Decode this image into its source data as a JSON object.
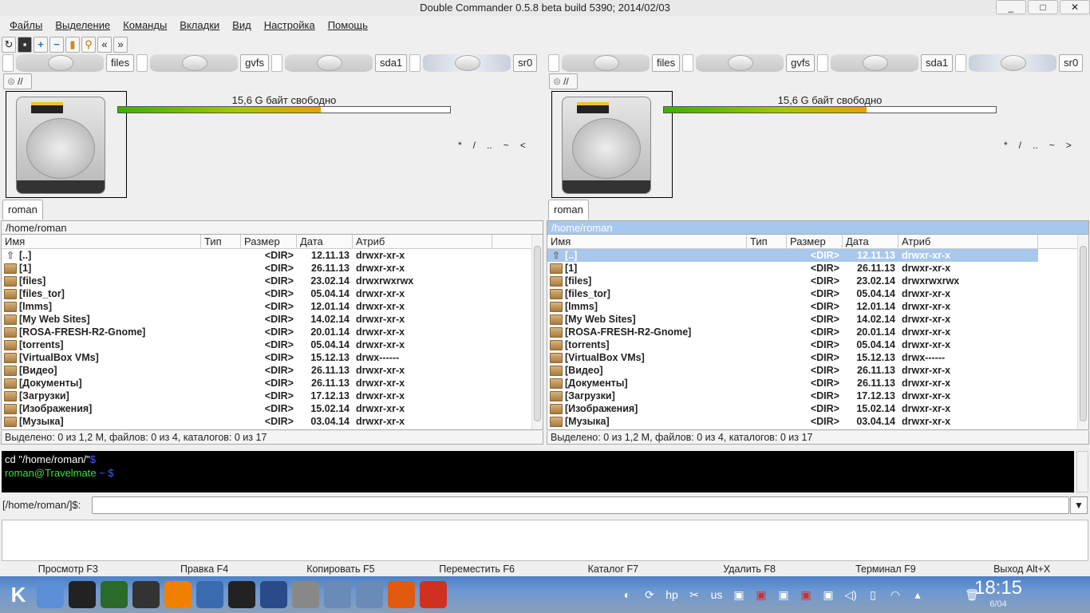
{
  "window": {
    "title": "Double Commander 0.5.8 beta build 5390; 2014/02/03",
    "minimize": "_",
    "maximize": "□",
    "close": "✕"
  },
  "menu": [
    "Файлы",
    "Выделение",
    "Команды",
    "Вкладки",
    "Вид",
    "Настройка",
    "Помощь"
  ],
  "toolbar": [
    "refresh-icon",
    "terminal-icon",
    "plus-icon",
    "minus-icon",
    "clipboard-icon",
    "search-icon",
    "back-icon",
    "forward-icon"
  ],
  "drives": [
    "files",
    "gvfs",
    "sda1",
    "sr0"
  ],
  "root_button": "//",
  "panels": [
    {
      "tab": "roman",
      "path": "/home/roman",
      "free_label": "15,6 G байт свободно",
      "used_fraction": 0.61,
      "nav": [
        "*",
        "/",
        "..",
        "~",
        "<"
      ],
      "active": false,
      "status": "Выделено: 0 из 1,2 M, файлов: 0 из 4, каталогов: 0 из 17"
    },
    {
      "tab": "roman",
      "path": "/home/roman",
      "free_label": "15,6 G байт свободно",
      "used_fraction": 0.61,
      "nav": [
        "*",
        "/",
        "..",
        "~",
        ">"
      ],
      "active": true,
      "status": "Выделено: 0 из 1,2 M, файлов: 0 из 4, каталогов: 0 из 17"
    }
  ],
  "columns": [
    "Имя",
    "Тип",
    "Размер",
    "Дата",
    "Атриб"
  ],
  "files": [
    {
      "name": "[..]",
      "size": "<DIR>",
      "date": "12.11.13",
      "attr": "drwxr-xr-x",
      "up": true
    },
    {
      "name": "[1]",
      "size": "<DIR>",
      "date": "26.11.13",
      "attr": "drwxr-xr-x"
    },
    {
      "name": "[files]",
      "size": "<DIR>",
      "date": "23.02.14",
      "attr": "drwxrwxrwx"
    },
    {
      "name": "[files_tor]",
      "size": "<DIR>",
      "date": "05.04.14",
      "attr": "drwxr-xr-x"
    },
    {
      "name": "[lmms]",
      "size": "<DIR>",
      "date": "12.01.14",
      "attr": "drwxr-xr-x"
    },
    {
      "name": "[My Web Sites]",
      "size": "<DIR>",
      "date": "14.02.14",
      "attr": "drwxr-xr-x"
    },
    {
      "name": "[ROSA-FRESH-R2-Gnome]",
      "size": "<DIR>",
      "date": "20.01.14",
      "attr": "drwxr-xr-x"
    },
    {
      "name": "[torrents]",
      "size": "<DIR>",
      "date": "05.04.14",
      "attr": "drwxr-xr-x"
    },
    {
      "name": "[VirtualBox VMs]",
      "size": "<DIR>",
      "date": "15.12.13",
      "attr": "drwx------"
    },
    {
      "name": "[Видео]",
      "size": "<DIR>",
      "date": "26.11.13",
      "attr": "drwxr-xr-x"
    },
    {
      "name": "[Документы]",
      "size": "<DIR>",
      "date": "26.11.13",
      "attr": "drwxr-xr-x"
    },
    {
      "name": "[Загрузки]",
      "size": "<DIR>",
      "date": "17.12.13",
      "attr": "drwxr-xr-x"
    },
    {
      "name": "[Изображения]",
      "size": "<DIR>",
      "date": "15.02.14",
      "attr": "drwxr-xr-x"
    },
    {
      "name": "[Музыка]",
      "size": "<DIR>",
      "date": "03.04.14",
      "attr": "drwxr-xr-x"
    }
  ],
  "terminal": {
    "line1": " cd \"/home/roman/\"",
    "line1_prompt": "$",
    "user": "roman@Travelmate",
    "tilde_prompt": " ~ $"
  },
  "command": {
    "label": "[/home/roman/]$:",
    "value": ""
  },
  "fkeys": [
    "Просмотр F3",
    "Правка F4",
    "Копировать F5",
    "Переместить F6",
    "Каталог F7",
    "Удалить F8",
    "Терминал F9",
    "Выход Alt+X"
  ],
  "taskbar": {
    "apps": [
      "kde-menu-icon",
      "file-manager-icon",
      "tux-icon",
      "video-editor-icon",
      "system-monitor-icon",
      "vlc-icon",
      "ksysguard-icon",
      "terminal-icon",
      "network-icon",
      "settings-icon",
      "folder-icon",
      "folder-download-icon",
      "firefox-icon",
      "double-commander-icon"
    ],
    "tray": [
      "double-commander-icon",
      "sync-icon",
      "hp-icon",
      "scissors-icon",
      "keyboard-layout",
      "network-icon",
      "network-disconnected-icon",
      "network-icon",
      "network-disconnected-icon",
      "network-icon",
      "volume-icon",
      "battery-icon",
      "wifi-icon",
      "arrow-up-icon",
      "trash-icon"
    ],
    "keyboard_layout": "us",
    "time": "18:15",
    "date": "6/04"
  }
}
